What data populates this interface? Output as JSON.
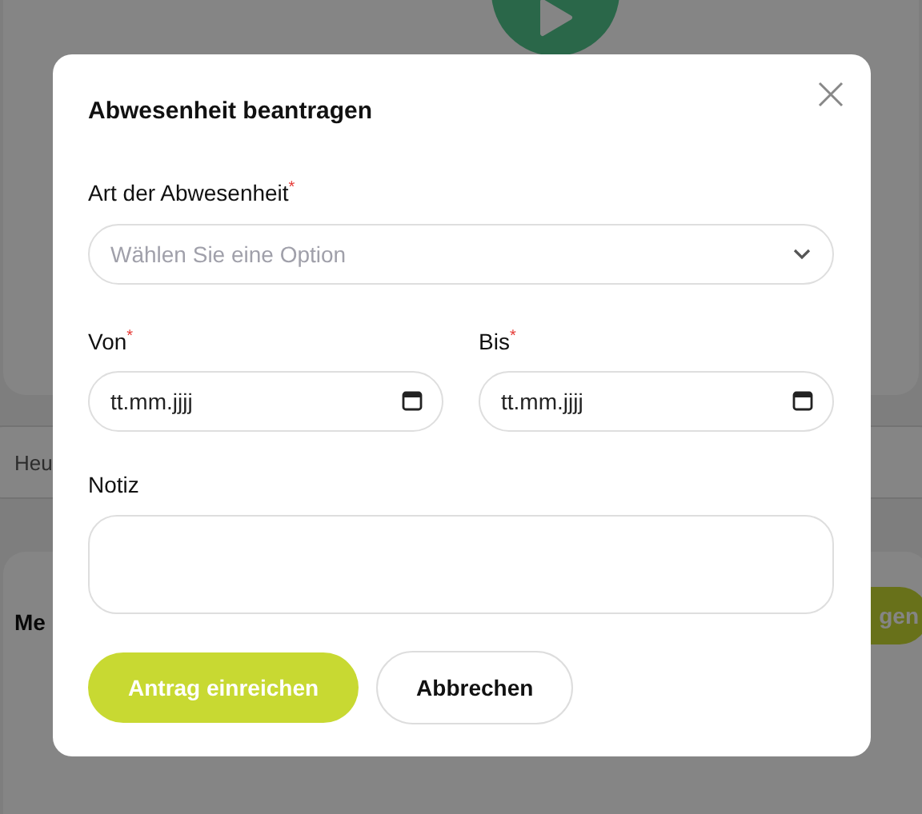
{
  "background": {
    "search_field": {
      "value": "Heu"
    },
    "card": {
      "title": "Me",
      "button": "gen"
    }
  },
  "dialog": {
    "title": "Abwesenheit beantragen",
    "required_mark": "*",
    "fields": [
      {
        "kind": "select",
        "label": "Art der Abwesenheit",
        "required": true,
        "placeholder": "Wählen Sie eine Option"
      },
      {
        "kind": "date",
        "label": "Von",
        "required": true,
        "placeholder": "tt.mm.jjjj"
      },
      {
        "kind": "date",
        "label": "Bis",
        "required": true,
        "placeholder": "tt.mm.jjjj"
      },
      {
        "kind": "textarea",
        "label": "Notiz",
        "required": false
      }
    ],
    "buttons": [
      {
        "label": "Antrag einreichen",
        "primary": true
      },
      {
        "label": "Abbrechen",
        "primary": false
      }
    ]
  }
}
